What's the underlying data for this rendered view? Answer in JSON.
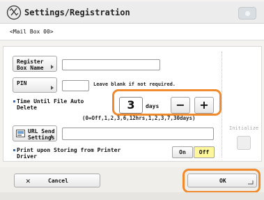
{
  "header": {
    "title": "Settings/Registration",
    "icon": "settings-registration-icon",
    "corner_icon": "info-icon"
  },
  "subtitle": "<Mail Box 00>",
  "form": {
    "register_box_name": {
      "label_line1": "Register",
      "label_line2": "Box Name",
      "value": ""
    },
    "pin": {
      "label": "PIN",
      "value": "",
      "hint": "Leave blank if not required."
    },
    "auto_delete": {
      "label_line1": "Time Until File Auto",
      "label_line2": "Delete",
      "value": "3",
      "unit": "days",
      "decrement": "−",
      "increment": "+",
      "range_text": "(0=Off,1,2,3,6,12hrs,1,2,3,7,30days)"
    },
    "url_send": {
      "label_line1": "URL Send",
      "label_line2": "Settings",
      "icon": "url-send-icon",
      "value": ""
    },
    "print_store": {
      "label_line1": "Print upon Storing from Printer",
      "label_line2": "Driver",
      "on_label": "On",
      "off_label": "Off",
      "selected": "Off"
    }
  },
  "side": {
    "initialize_label": "Initialize"
  },
  "footer": {
    "cancel_label": "Cancel",
    "ok_label": "OK"
  },
  "colors": {
    "highlight": "#ef8a2d",
    "selected_toggle": "#fff79a",
    "bullet": "#2f6fb3"
  }
}
